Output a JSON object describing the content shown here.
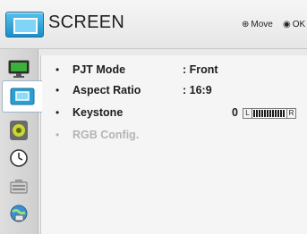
{
  "header": {
    "title": "SCREEN",
    "hints": [
      {
        "glyph": "⊕",
        "label": "Move"
      },
      {
        "glyph": "◉",
        "label": "OK"
      }
    ],
    "icon": "screen-icon"
  },
  "sidebar": {
    "tabs": [
      {
        "icon": "picture-icon",
        "selected": false
      },
      {
        "icon": "screen-icon",
        "selected": true
      },
      {
        "icon": "audio-icon",
        "selected": false
      },
      {
        "icon": "clock-icon",
        "selected": false
      },
      {
        "icon": "options-icon",
        "selected": false
      },
      {
        "icon": "network-icon",
        "selected": false
      }
    ]
  },
  "menu": {
    "items": [
      {
        "label": "PJT Mode",
        "value": ": Front",
        "enabled": true
      },
      {
        "label": "Aspect Ratio",
        "value": ": 16:9",
        "enabled": true
      },
      {
        "label": "Keystone",
        "value": "0",
        "enabled": true
      },
      {
        "label": "RGB Config.",
        "value": "",
        "enabled": false
      }
    ],
    "keystone_slider": {
      "left_label": "L",
      "right_label": "R",
      "level": 0
    }
  },
  "colors": {
    "accent": "#1a8ec6",
    "disabled_text": "#b4b4b4",
    "text": "#1d1d1d"
  }
}
